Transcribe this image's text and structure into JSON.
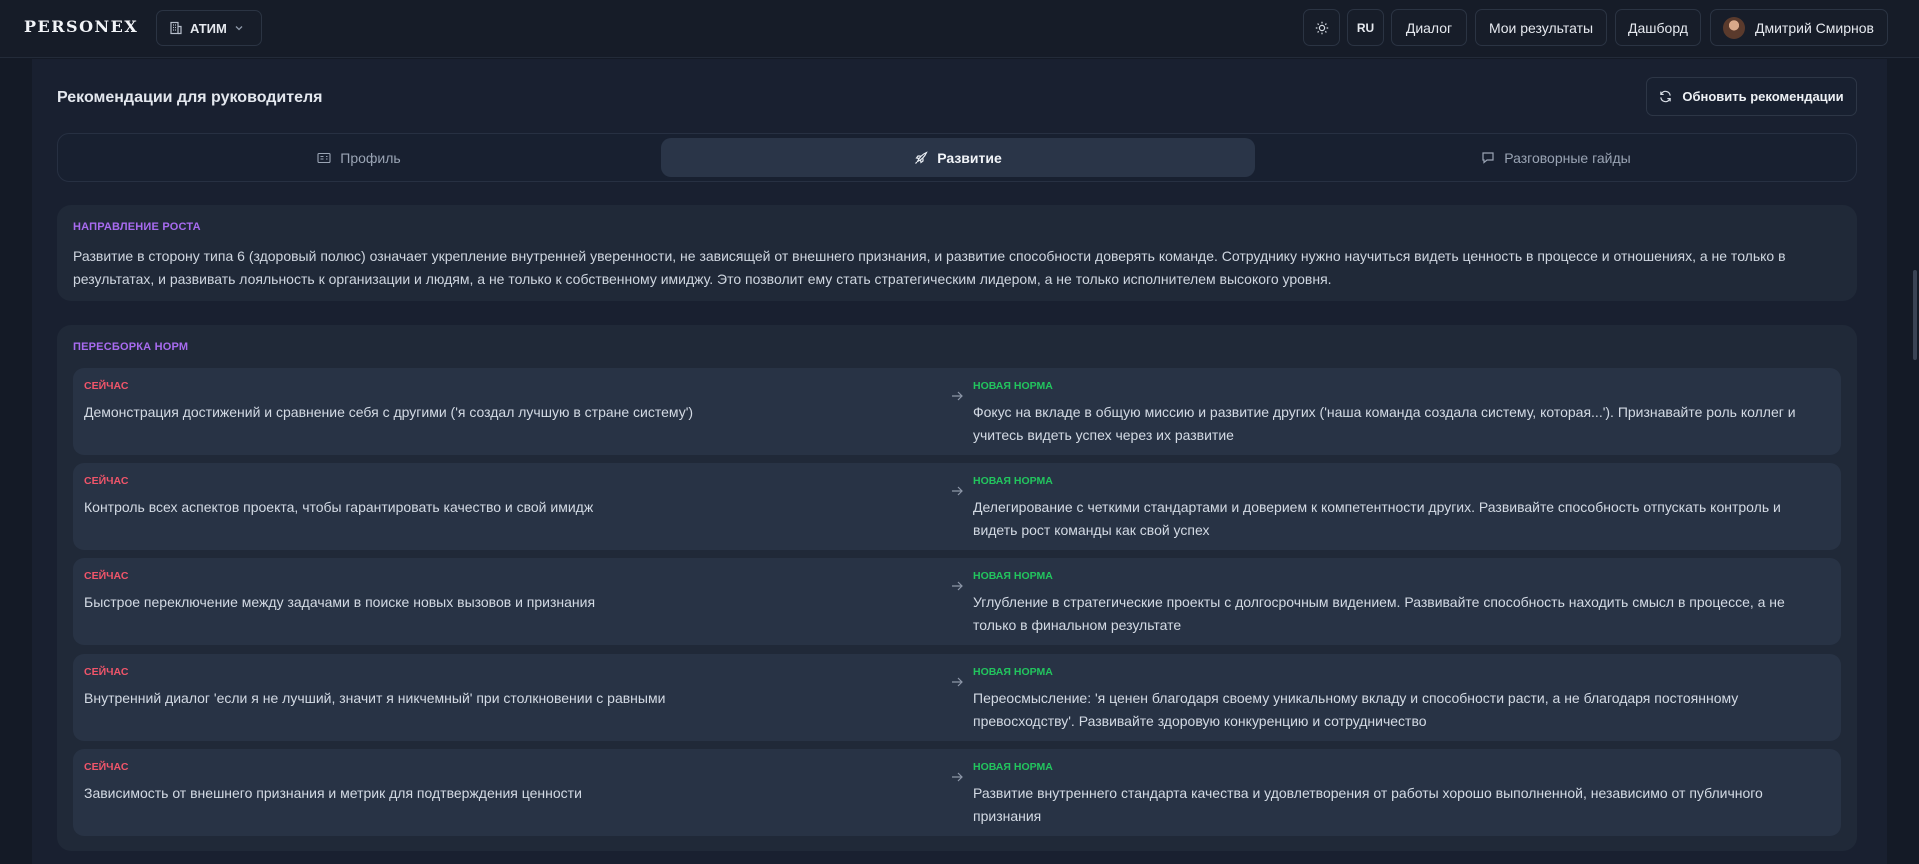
{
  "header": {
    "logo": "PERSONEX",
    "org": "АТИМ",
    "lang": "RU",
    "nav": [
      "Диалог",
      "Мои результаты",
      "Дашборд"
    ],
    "user_name": "Дмитрий Смирнов",
    "icons": {
      "org": "building-icon",
      "org_chevron": "chevron-down-icon",
      "theme": "sun-icon"
    }
  },
  "page": {
    "title": "Рекомендации для руководителя",
    "refresh_label": "Обновить рекомендации",
    "refresh_icon": "refresh-icon"
  },
  "tabs": [
    {
      "label": "Профиль",
      "icon": "id-card-icon",
      "active": false
    },
    {
      "label": "Развитие",
      "icon": "rocket-icon",
      "active": true
    },
    {
      "label": "Разговорные гайды",
      "icon": "chat-icon",
      "active": false
    }
  ],
  "growth": {
    "title": "НАПРАВЛЕНИЕ РОСТА",
    "text": "Развитие в сторону типа 6 (здоровый полюс) означает укрепление внутренней уверенности, не зависящей от внешнего признания, и развитие способности доверять команде. Сотруднику нужно научиться видеть ценность в процессе и отношениях, а не только в результатах, и развивать лояльность к организации и людям, а не только к собственному имиджу. Это позволит ему стать стратегическим лидером, а не только исполнителем высокого уровня."
  },
  "norms": {
    "title": "ПЕРЕСБОРКА НОРМ",
    "now_label": "СЕЙЧАС",
    "new_label": "НОВАЯ НОРМА",
    "rows": [
      {
        "now": "Демонстрация достижений и сравнение себя с другими ('я создал лучшую в стране систему')",
        "new": "Фокус на вкладе в общую миссию и развитие других ('наша команда создала систему, которая...'). Признавайте роль коллег и учитесь видеть успех через их развитие"
      },
      {
        "now": "Контроль всех аспектов проекта, чтобы гарантировать качество и свой имидж",
        "new": "Делегирование с четкими стандартами и доверием к компетентности других. Развивайте способность отпускать контроль и видеть рост команды как свой успех"
      },
      {
        "now": "Быстрое переключение между задачами в поиске новых вызовов и признания",
        "new": "Углубление в стратегические проекты с долгосрочным видением. Развивайте способность находить смысл в процессе, а не только в финальном результате"
      },
      {
        "now": "Внутренний диалог 'если я не лучший, значит я никчемный' при столкновении с равными",
        "new": "Переосмысление: 'я ценен благодаря своему уникальному вкладу и способности расти, а не благодаря постоянному превосходству'. Развивайте здоровую конкуренцию и сотрудничество"
      },
      {
        "now": "Зависимость от внешнего признания и метрик для подтверждения ценности",
        "new": "Развитие внутреннего стандарта качества и удовлетворения от работы хорошо выполненной, независимо от публичного признания"
      }
    ]
  }
}
